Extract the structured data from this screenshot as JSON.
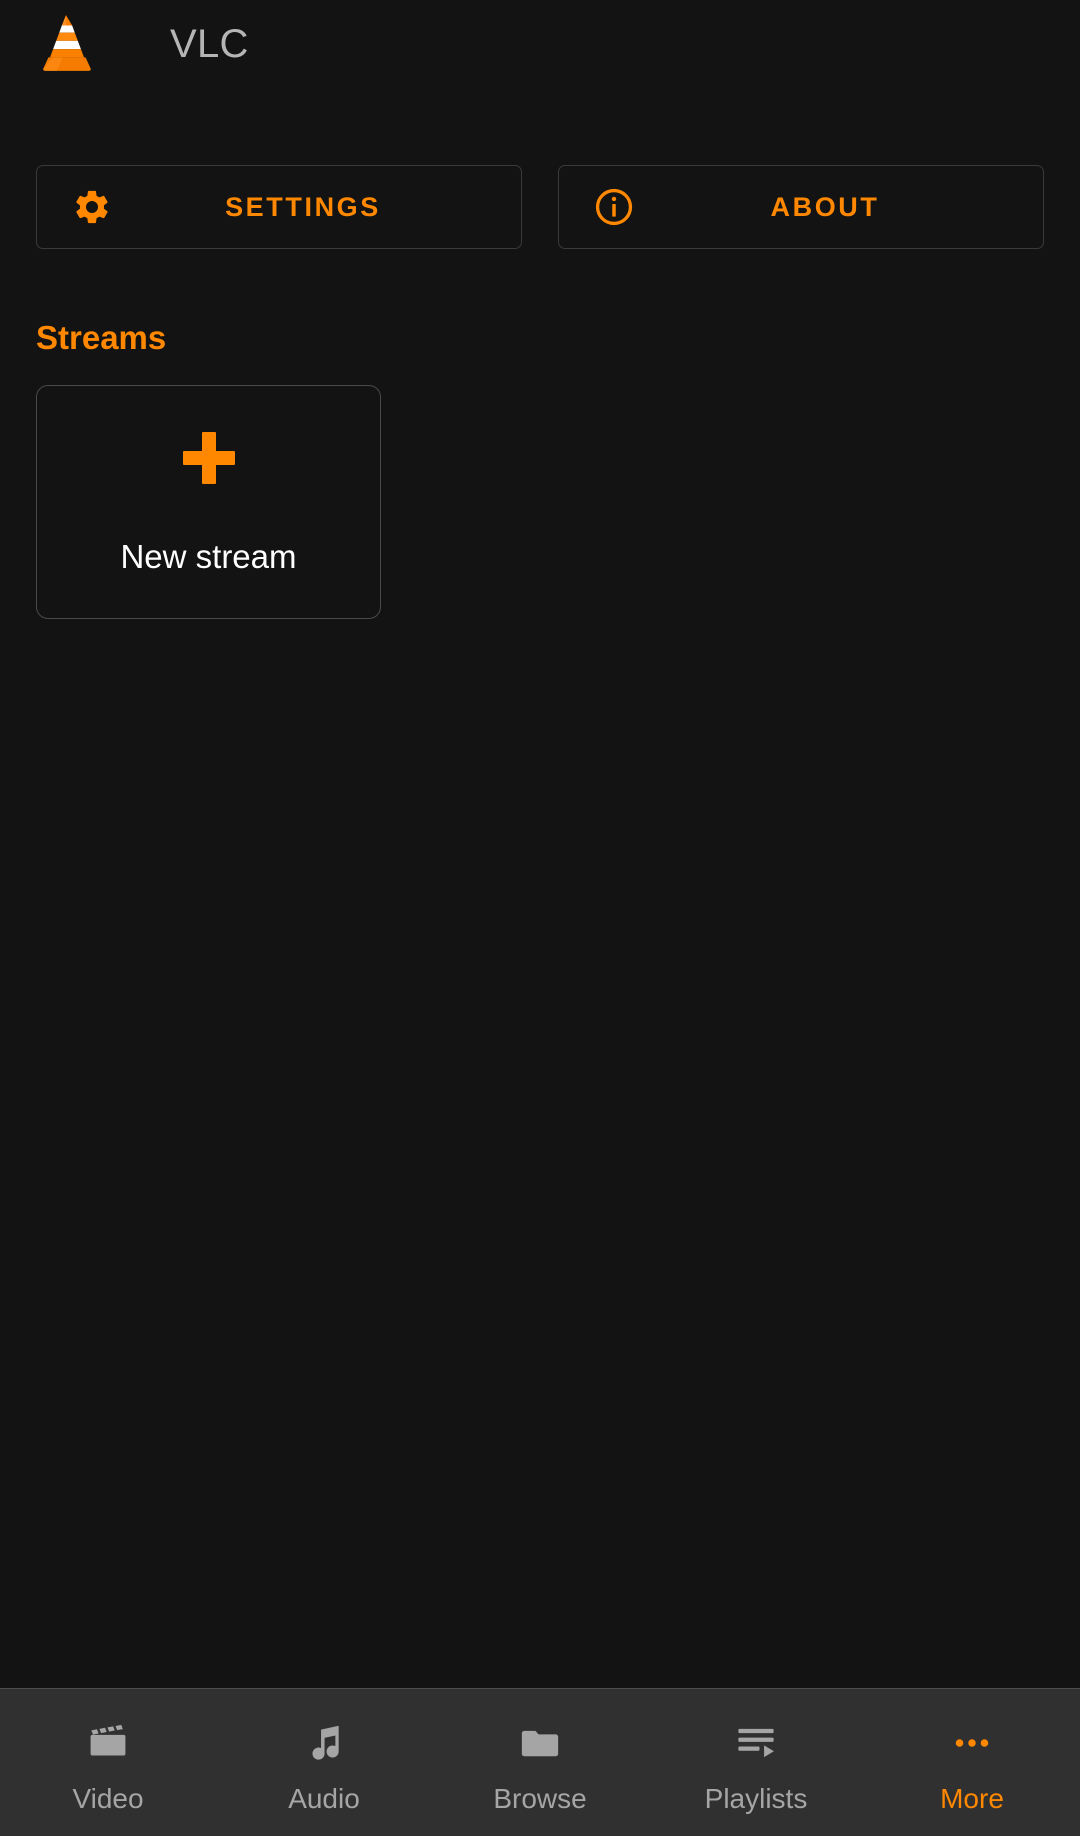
{
  "app": {
    "name": "VLC",
    "logo_icon": "vlc-cone-icon",
    "background_color": "#131313",
    "accent_color": "#ff8800"
  },
  "actions": [
    {
      "label": "SETTINGS",
      "icon": "gear-icon",
      "name": "settings-button"
    },
    {
      "label": "ABOUT",
      "icon": "info-circle-icon",
      "name": "about-button"
    }
  ],
  "streams": {
    "section_title": "Streams",
    "cards": [
      {
        "label": "New stream",
        "icon": "plus-icon"
      }
    ]
  },
  "bottom_nav": {
    "items": [
      {
        "label": "Video",
        "icon": "movie-clapper-icon",
        "active": false
      },
      {
        "label": "Audio",
        "icon": "music-note-icon",
        "active": false
      },
      {
        "label": "Browse",
        "icon": "folder-icon",
        "active": false
      },
      {
        "label": "Playlists",
        "icon": "playlist-play-icon",
        "active": false
      },
      {
        "label": "More",
        "icon": "more-dots-icon",
        "active": true
      }
    ],
    "active_color": "#ff8800",
    "inactive_color": "#a5a5a5"
  }
}
